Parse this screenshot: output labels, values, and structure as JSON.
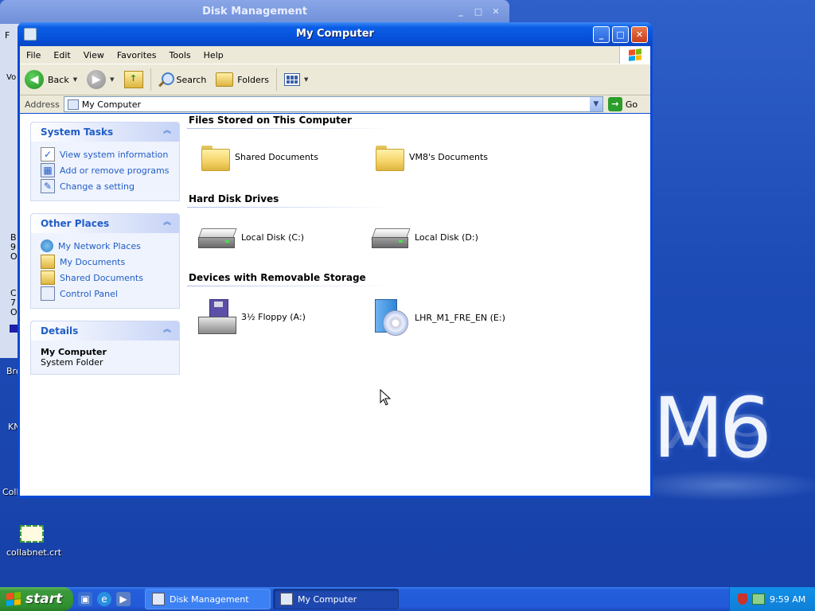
{
  "desktop": {
    "watermark": "M6",
    "icon_label": "collabnet.crt",
    "partial_labels": [
      "Bro",
      "KN",
      "Coll"
    ]
  },
  "back_window": {
    "title": "Disk Management",
    "strip_labels": [
      "F",
      "Vo",
      "B",
      "9",
      "O",
      "C",
      "7",
      "O"
    ]
  },
  "window": {
    "title": "My Computer",
    "controls": {
      "minimize": "_",
      "maximize": "□",
      "close": "✕"
    },
    "menu": [
      "File",
      "Edit",
      "View",
      "Favorites",
      "Tools",
      "Help"
    ],
    "toolbar": {
      "back": "Back",
      "search": "Search",
      "folders": "Folders"
    },
    "address": {
      "label": "Address",
      "value": "My Computer",
      "go": "Go"
    }
  },
  "sidebar": {
    "system_tasks": {
      "title": "System Tasks",
      "items": [
        "View system information",
        "Add or remove programs",
        "Change a setting"
      ]
    },
    "other_places": {
      "title": "Other Places",
      "items": [
        "My Network Places",
        "My Documents",
        "Shared Documents",
        "Control Panel"
      ]
    },
    "details": {
      "title": "Details",
      "name": "My Computer",
      "desc": "System Folder"
    }
  },
  "main": {
    "sections": [
      {
        "title": "Files Stored on This Computer",
        "items": [
          "Shared Documents",
          "VM8's Documents"
        ]
      },
      {
        "title": "Hard Disk Drives",
        "items": [
          "Local Disk (C:)",
          "Local Disk (D:)"
        ]
      },
      {
        "title": "Devices with Removable Storage",
        "items": [
          "3½ Floppy (A:)",
          "LHR_M1_FRE_EN (E:)"
        ]
      }
    ]
  },
  "taskbar": {
    "start": "start",
    "tasks": [
      "Disk Management",
      "My Computer"
    ],
    "clock": "9:59 AM"
  },
  "colors": {
    "titlebar": "#0650d8",
    "task_link": "#215dc6",
    "desktop": "#1d4bb6"
  }
}
